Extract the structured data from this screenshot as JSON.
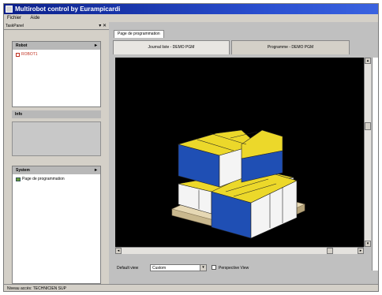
{
  "window": {
    "title": "Multirobot control by Eurampicardi"
  },
  "menu": {
    "items": [
      "Fichier",
      "Aide"
    ]
  },
  "taskpanel": {
    "label": "TaskPanel",
    "controls": "▾ ✕"
  },
  "panels": {
    "robot": {
      "title": "Robot",
      "item": "ROBOT1"
    },
    "info": {
      "title": "Info"
    },
    "system": {
      "title": "System",
      "item": "Page de programmation"
    }
  },
  "main": {
    "tab": "Page de programmation",
    "subtabs": [
      "Journal liste - DEMO PGM",
      "Programme - DEMO PGM"
    ],
    "default_view_label": "Default view",
    "default_view_value": "Custom",
    "perspective_label": "Perspective View"
  },
  "status": {
    "text": "Niveau accès: TECHNICIEN SUP"
  },
  "colors": {
    "box_yellow": "#ecd82a",
    "box_blue": "#1f4fb4",
    "pallet": "#e6d8b4"
  }
}
